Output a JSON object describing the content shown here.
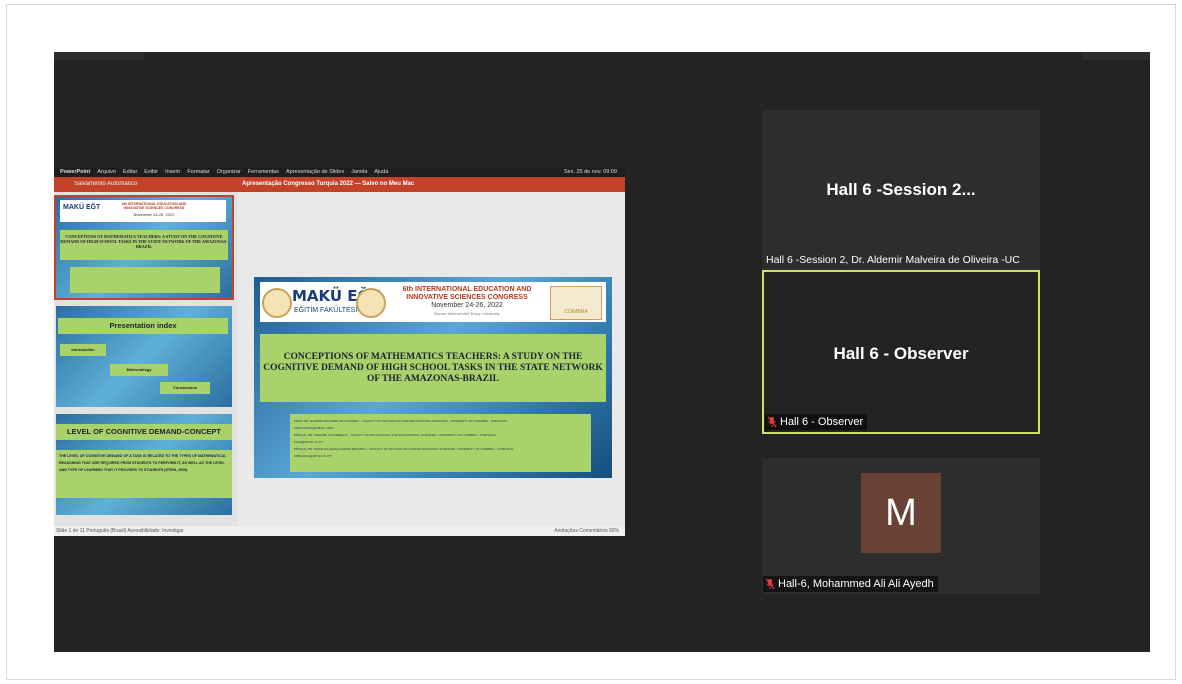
{
  "meeting": {
    "top_left_label": "",
    "top_right_label": ""
  },
  "share": {
    "menubar": [
      "PowerPoint",
      "Arquivo",
      "Editar",
      "Exibir",
      "Inserir",
      "Formatar",
      "Organizar",
      "Ferramentas",
      "Apresentação de Slides",
      "Janela",
      "Ajuda"
    ],
    "clock": "Sex. 25 de nov. 09:09",
    "autosave": "Salvamento Automático",
    "document_title": "Apresentação Congresso Turquia 2022 — Salvo no Meu Mac",
    "thumb1": {
      "congress": "6th INTERNATIONAL EDUCATION AND INNOVATIVE SCIENCES CONGRESS",
      "dates": "November 24-26, 2022",
      "title": "CONCEPTIONS OF MATHEMATICS TEACHERS: A STUDY ON THE COGNITIVE DEMAND OF HIGH SCHOOL TASKS IN THE STATE NETWORK OF THE AMAZONAS-BRAZIL"
    },
    "thumb2": {
      "title": "Presentation index",
      "items": [
        "Introduction",
        "Methodology",
        "Conclusions"
      ]
    },
    "thumb3": {
      "title": "LEVEL OF COGNITIVE DEMAND-CONCEPT",
      "body": "THE LEVEL OF COGNITIVE DEMAND OF A TASK IS RELATED TO THE TYPES OF MATHEMATICAL REASONING THAT ARE REQUIRED FROM STUDENTS TO PERFORM IT, AS WELL AS THE LEVEL AND TYPE OF LEARNING THAT IT PROVIDES TO STUDENTS (STEIN, 2009)."
    },
    "slide": {
      "logo": "MAKÜ EĞT",
      "logo_sub": "EĞİTİM FAKÜLTESİ",
      "congress_line1": "6th INTERNATIONAL EDUCATION AND",
      "congress_line2": "INNOVATIVE SCIENCES CONGRESS",
      "dates": "November 24-26, 2022",
      "university": "Burdur Mehmet Akif Ersoy University",
      "coimbra": "COIMBRA",
      "title": "CONCEPTIONS OF MATHEMATICS TEACHERS: A STUDY ON THE COGNITIVE DEMAND OF HIGH SCHOOL TASKS IN THE STATE NETWORK OF THE AMAZONAS-BRAZIL",
      "authors": [
        "PROF. DR. ALDEMIR MALVEIRA DE OLIVEIRA¹ – FACULTY OF PSYCHOLOGY AND EDUCATIONAL SCIENCES - UNIVERSITY OF COIMBRA – PORTUGAL",
        "AMOLIVEIRA@GMAIL.COM ¹",
        "PROF(A). DR. PIEDADE VAZ REBELO² – FACULTY OF PSYCHOLOGY AND EDUCATIONAL SCIENCES - UNIVERSITY OF COIMBRA – PORTUGAL",
        "PVAZ@FPCE.UC.PT²",
        "PROF(A). DR. MARIA DA GRAÇA AMARO BIDARRA³ – FACULTY OF PSYCHOLOGY AND EDUCATIONAL SCIENCES- UNIVERSITY OF COIMBRA – PORTUGAL",
        "GBIDARRA@FPCE.UC.PT³"
      ]
    },
    "status_left": "Slide 1 de 11    Português (Brasil)    Acessibilidade: Investigar",
    "status_right": "Anotações    Comentários                    92%"
  },
  "tiles": [
    {
      "name": "Hall 6 -Session 2...",
      "caption": "Hall 6 -Session 2, Dr. Aldemir Malveira de Oliveira -UC"
    },
    {
      "name": "Hall 6 - Observer",
      "caption": "Hall 6 - Observer"
    },
    {
      "avatar": "M",
      "caption": "Hall-6, Mohammed Ali Ali Ayedh"
    }
  ],
  "colors": {
    "meeting_bg": "#232323",
    "tile_bg": "#2d2d2d",
    "active_speaker": "#cfe06a",
    "ppt_red": "#c3432a",
    "slide_green": "#a8d26a",
    "avatar_bg": "#6a4135",
    "mute_red": "#e03c3c"
  },
  "icons": [
    "mic-muted-icon"
  ]
}
